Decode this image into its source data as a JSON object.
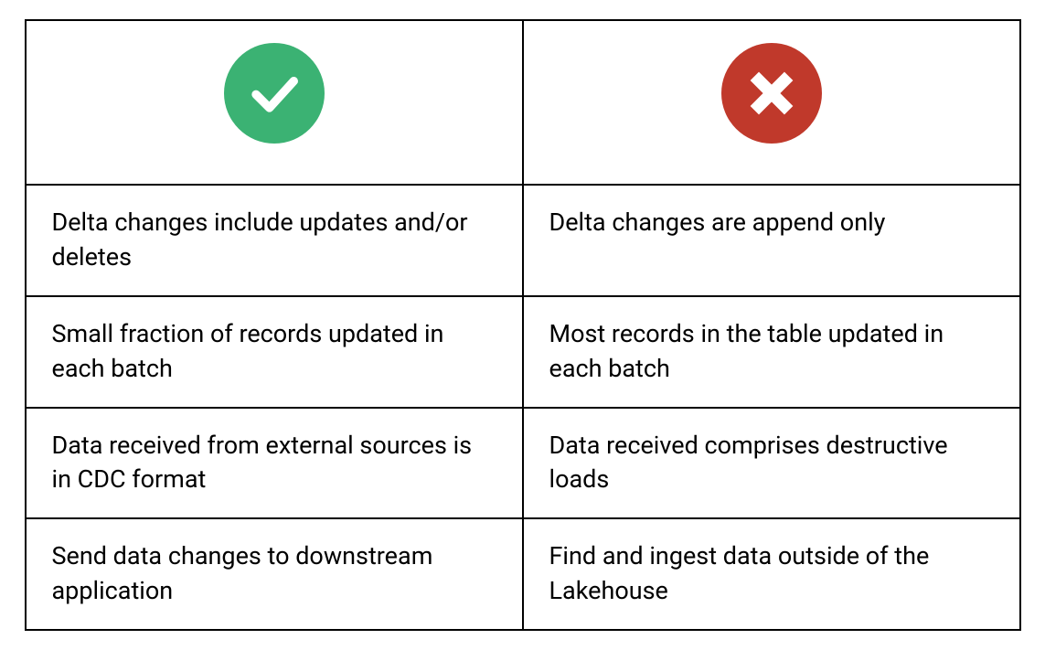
{
  "colors": {
    "good": "#3bb273",
    "bad": "#c0392b"
  },
  "table": {
    "header": {
      "good_icon": "checkmark-icon",
      "bad_icon": "x-icon"
    },
    "rows": [
      {
        "good": "Delta changes include updates and/or deletes",
        "bad": "Delta changes are append only"
      },
      {
        "good": "Small fraction of records updated in each batch",
        "bad": "Most records in the table updated in each batch"
      },
      {
        "good": "Data received from external sources is in CDC format",
        "bad": "Data received comprises destructive loads"
      },
      {
        "good": "Send data changes to downstream application",
        "bad": "Find and ingest data outside of the Lakehouse"
      }
    ]
  }
}
